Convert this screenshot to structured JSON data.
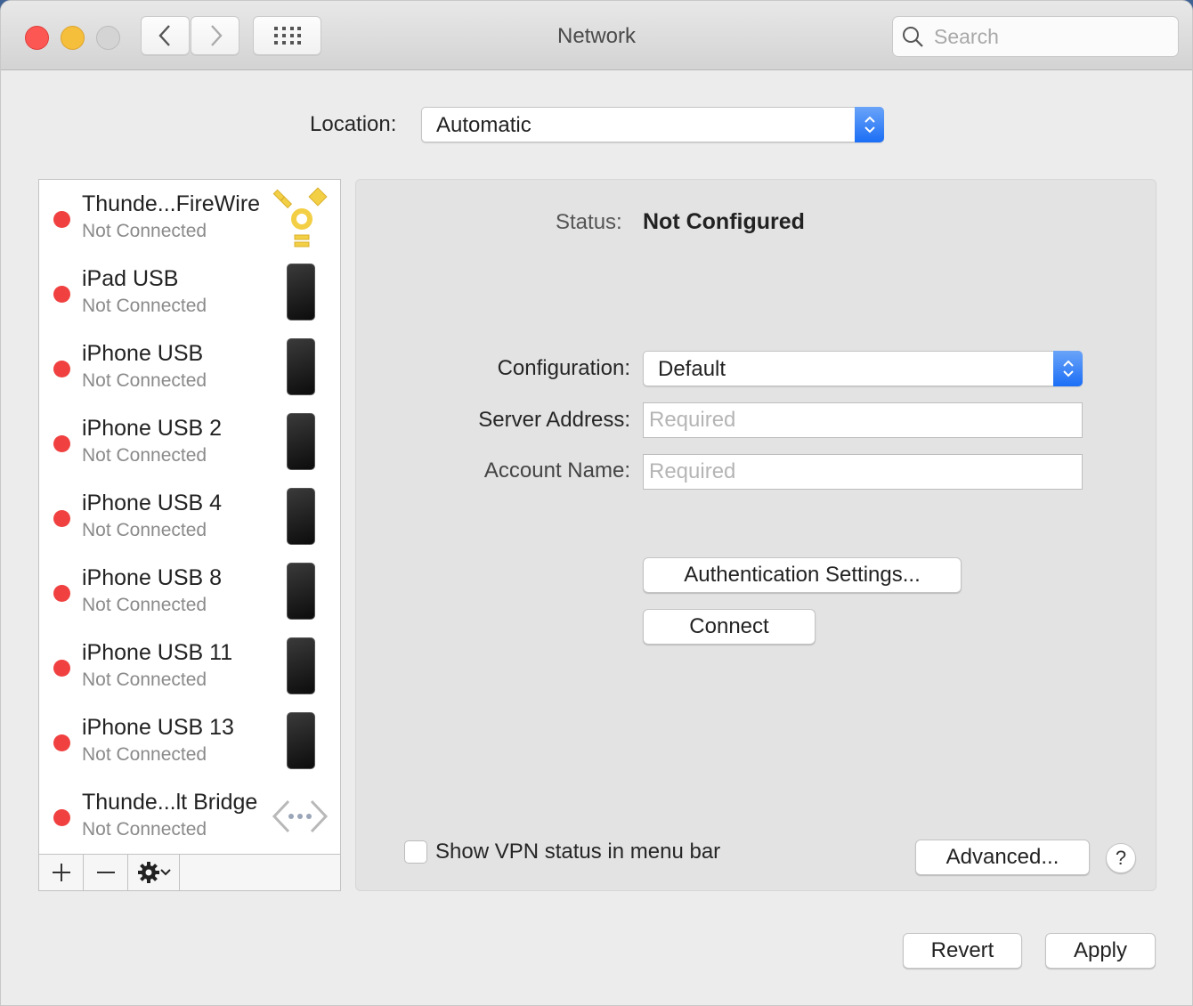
{
  "window": {
    "title": "Network",
    "search_placeholder": "Search"
  },
  "location": {
    "label": "Location:",
    "value": "Automatic"
  },
  "services": [
    {
      "name": "Thunde...FireWire",
      "state": "Not Connected",
      "status_color": "#f04040",
      "icon": "firewire-icon"
    },
    {
      "name": "iPad USB",
      "state": "Not Connected",
      "status_color": "#f04040",
      "icon": "iphone-icon"
    },
    {
      "name": "iPhone USB",
      "state": "Not Connected",
      "status_color": "#f04040",
      "icon": "iphone-icon"
    },
    {
      "name": "iPhone USB 2",
      "state": "Not Connected",
      "status_color": "#f04040",
      "icon": "iphone-icon"
    },
    {
      "name": "iPhone USB 4",
      "state": "Not Connected",
      "status_color": "#f04040",
      "icon": "iphone-icon"
    },
    {
      "name": "iPhone USB 8",
      "state": "Not Connected",
      "status_color": "#f04040",
      "icon": "iphone-icon"
    },
    {
      "name": "iPhone USB 11",
      "state": "Not Connected",
      "status_color": "#f04040",
      "icon": "iphone-icon"
    },
    {
      "name": "iPhone USB 13",
      "state": "Not Connected",
      "status_color": "#f04040",
      "icon": "iphone-icon"
    },
    {
      "name": "Thunde...lt Bridge",
      "state": "Not Connected",
      "status_color": "#f04040",
      "icon": "thunderbolt-bridge-icon"
    }
  ],
  "sidebar_toolbar": {
    "add": "+",
    "remove": "−"
  },
  "detail": {
    "status_label": "Status:",
    "status_value": "Not Configured",
    "configuration_label": "Configuration:",
    "configuration_value": "Default",
    "server_address_label": "Server Address:",
    "server_address_placeholder": "Required",
    "server_address_value": "",
    "account_name_label": "Account Name:",
    "account_name_placeholder": "Required",
    "account_name_value": "",
    "auth_button": "Authentication Settings...",
    "connect_button": "Connect",
    "show_vpn_label": "Show VPN status in menu bar",
    "show_vpn_checked": false,
    "advanced_button": "Advanced...",
    "help_button": "?"
  },
  "footer": {
    "revert": "Revert",
    "apply": "Apply"
  },
  "colors": {
    "accent": "#1b6ef6",
    "status_disconnected": "#f04040"
  }
}
